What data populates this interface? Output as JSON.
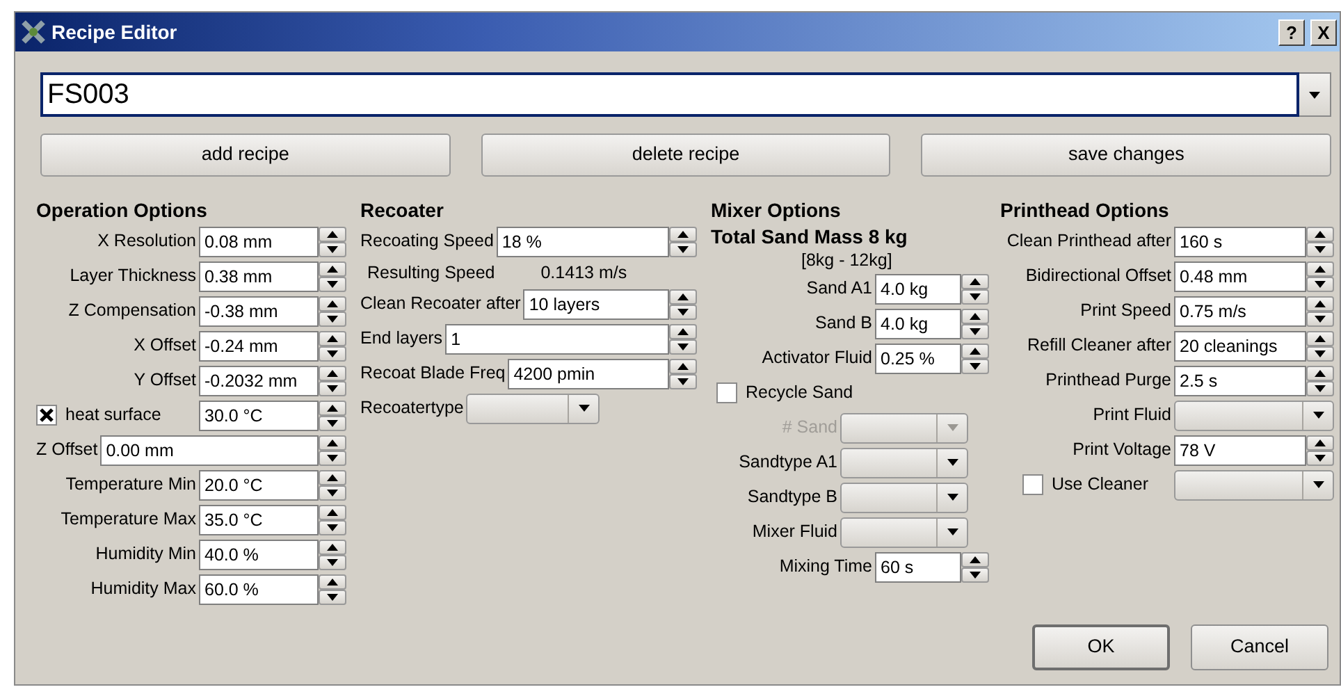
{
  "window": {
    "title": "Recipe Editor",
    "title_buttons": [
      "?",
      "X"
    ]
  },
  "recipe": {
    "value": "FS003"
  },
  "actions": [
    "add recipe",
    "delete recipe",
    "save changes"
  ],
  "columns": [
    {
      "heading": "Operation Options",
      "rows": [
        {
          "kind": "spin",
          "label": "X Resolution",
          "value": "0.08 mm"
        },
        {
          "kind": "spin",
          "label": "Layer Thickness",
          "value": "0.38 mm"
        },
        {
          "kind": "spin",
          "label": "Z Compensation",
          "value": "-0.38 mm"
        },
        {
          "kind": "spin",
          "label": "X Offset",
          "value": "-0.24 mm"
        },
        {
          "kind": "spin",
          "label": "Y Offset",
          "value": "-0.2032 mm"
        },
        {
          "kind": "checkspin",
          "label": "heat surface",
          "checked": true,
          "value": "30.0 °C"
        },
        {
          "kind": "widespin",
          "label": "Z Offset",
          "value": "0.00 mm"
        },
        {
          "kind": "spin",
          "label": "Temperature Min",
          "value": "20.0 °C"
        },
        {
          "kind": "spin",
          "label": "Temperature Max",
          "value": "35.0 °C"
        },
        {
          "kind": "spin",
          "label": "Humidity Min",
          "value": "40.0 %"
        },
        {
          "kind": "spin",
          "label": "Humidity Max",
          "value": "60.0 %"
        }
      ]
    },
    {
      "heading": "Recoater",
      "rows": [
        {
          "kind": "spin",
          "label": "Recoating Speed",
          "value": "18 %"
        },
        {
          "kind": "readout",
          "label": "Resulting Speed",
          "value": "0.1413 m/s"
        },
        {
          "kind": "spin",
          "label": "Clean Recoater after",
          "value": "10 layers"
        },
        {
          "kind": "spin",
          "label": "End layers",
          "value": "1"
        },
        {
          "kind": "spin",
          "label": "Recoat Blade Freq",
          "value": "4200 pmin"
        },
        {
          "kind": "combo",
          "label": "Recoatertype",
          "disabled": false
        }
      ]
    },
    {
      "heading": "Mixer Options",
      "rows": [
        {
          "kind": "subheading",
          "label": "Total Sand Mass 8 kg"
        },
        {
          "kind": "note",
          "label": "[8kg - 12kg]"
        },
        {
          "kind": "spin",
          "label": "Sand A1",
          "value": "4.0 kg"
        },
        {
          "kind": "spin",
          "label": "Sand B",
          "value": "4.0 kg"
        },
        {
          "kind": "spin",
          "label": "Activator Fluid",
          "value": "0.25 %"
        },
        {
          "kind": "check",
          "label": "Recycle Sand",
          "checked": false
        },
        {
          "kind": "combo",
          "label": "# Sand",
          "disabled": true
        },
        {
          "kind": "combo",
          "label": "Sandtype A1",
          "disabled": false
        },
        {
          "kind": "combo",
          "label": "Sandtype B",
          "disabled": false
        },
        {
          "kind": "combo",
          "label": "Mixer Fluid",
          "disabled": false
        },
        {
          "kind": "spin",
          "label": "Mixing Time",
          "value": "60 s"
        }
      ]
    },
    {
      "heading": "Printhead Options",
      "rows": [
        {
          "kind": "spin",
          "label": "Clean Printhead after",
          "value": "160 s"
        },
        {
          "kind": "spin",
          "label": "Bidirectional Offset",
          "value": "0.48 mm"
        },
        {
          "kind": "spin",
          "label": "Print Speed",
          "value": "0.75 m/s"
        },
        {
          "kind": "spin",
          "label": "Refill Cleaner after",
          "value": "20 cleanings"
        },
        {
          "kind": "spin",
          "label": "Printhead Purge",
          "value": "2.5 s"
        },
        {
          "kind": "combo",
          "label": "Print Fluid",
          "disabled": false
        },
        {
          "kind": "spin",
          "label": "Print Voltage",
          "value": "78 V"
        },
        {
          "kind": "checkcombo",
          "label": "Use Cleaner",
          "checked": false
        }
      ]
    }
  ],
  "buttons": [
    "OK",
    "Cancel"
  ]
}
